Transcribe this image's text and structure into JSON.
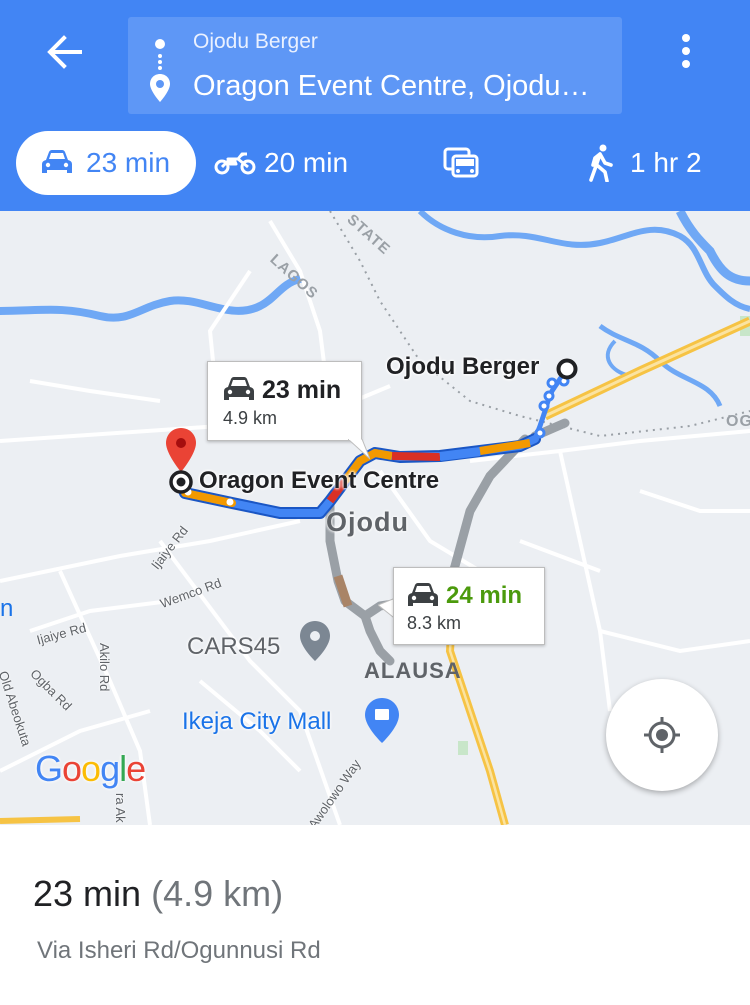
{
  "header": {
    "origin": "Ojodu Berger",
    "destination": "Oragon Event Centre, Ojodu…",
    "modes": [
      {
        "name": "drive",
        "label": "23 min",
        "active": true
      },
      {
        "name": "motorcycle",
        "label": "20 min",
        "active": false
      },
      {
        "name": "transit",
        "label": "",
        "active": false
      },
      {
        "name": "walk",
        "label": "1 hr 2",
        "active": false
      }
    ]
  },
  "map": {
    "labels": {
      "origin": "Ojodu Berger",
      "destination": "Oragon Event Centre",
      "district_ojodu": "Ojodu",
      "district_alausa": "ALAUSA",
      "lagos": "LAGOS",
      "state": "STATE",
      "og": "OG",
      "n": "n",
      "ijaiye_rd_1": "Ijaiye Rd",
      "ijaiye_rd_2": "Ijaiye Rd",
      "wemco_rd": "Wemco Rd",
      "ogba_rd": "Ogba Rd",
      "akilo_rd": "Akilo Rd",
      "old_abeokuta": "Old Abeokuta",
      "awolowo_way": "Awolowo Way",
      "ra_ak": "ra Ak",
      "cars45": "CARS45",
      "ikeja_mall": "Ikeja City Mall"
    },
    "route_primary": {
      "time": "23 min",
      "distance": "4.9 km"
    },
    "route_alternate": {
      "time": "24 min",
      "distance": "8.3 km"
    },
    "google_logo": [
      "G",
      "o",
      "o",
      "g",
      "l",
      "e"
    ],
    "colors": {
      "route_blue": "#4285f4",
      "traffic_orange": "#f29900",
      "traffic_red": "#d93025",
      "alt_route_gray": "#9aa0a6",
      "alt_time_green": "#4b9a0c",
      "water": "#6fa8f5",
      "highway": "#f6c344"
    }
  },
  "sheet": {
    "time": "23 min",
    "distance": "(4.9 km)",
    "via": "Via Isheri Rd/Ogunnusi Rd"
  }
}
